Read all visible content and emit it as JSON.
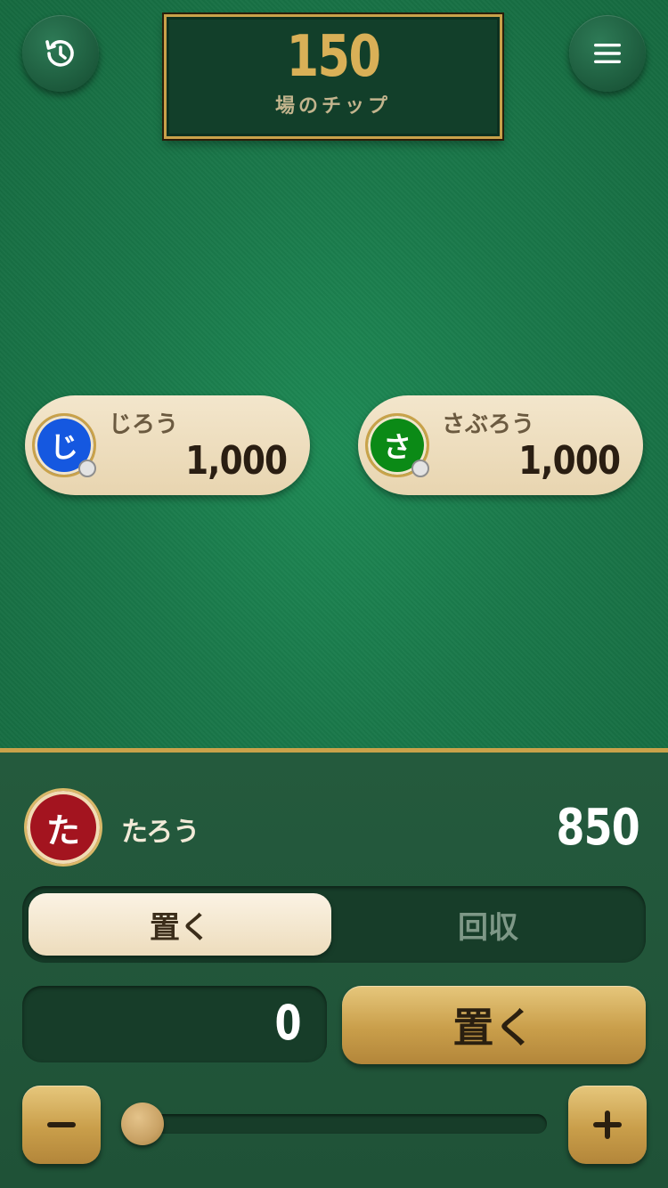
{
  "pot": {
    "amount": "150",
    "label": "場のチップ"
  },
  "header": {
    "history_icon": "history-icon",
    "menu_icon": "hamburger-menu-icon"
  },
  "players": [
    {
      "initial": "じ",
      "name": "じろう",
      "chips": "1,000",
      "color": "#1558e0"
    },
    {
      "initial": "さ",
      "name": "さぶろう",
      "chips": "1,000",
      "color": "#0b8a16"
    }
  ],
  "me": {
    "initial": "た",
    "name": "たろう",
    "chips": "850",
    "color": "#a3141f"
  },
  "mode": {
    "place_label": "置く",
    "collect_label": "回収",
    "selected": "place"
  },
  "bet": {
    "value": "0",
    "action_label": "置く",
    "slider_fraction": 0
  },
  "colors": {
    "accent_gold": "#c9a24a",
    "felt_green": "#1f7a4c",
    "panel_green": "#245a3d"
  }
}
